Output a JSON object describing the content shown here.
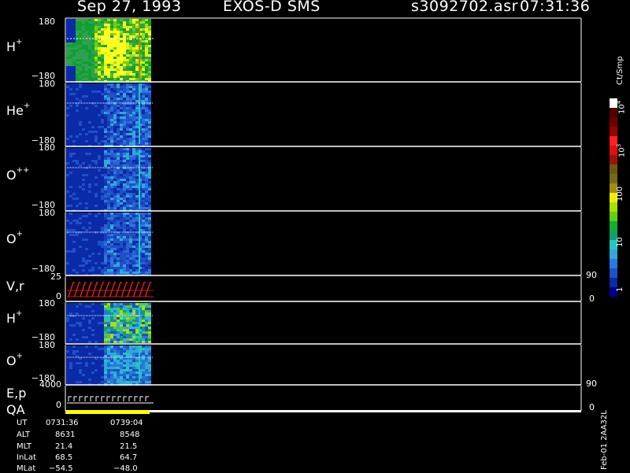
{
  "header": {
    "date": "Sep 27, 1993",
    "instrument": "EXOS-D SMS",
    "file": "s3092702.asr",
    "time": "07:31:36"
  },
  "panels": {
    "h_plus": {
      "label": "H",
      "sup": "+",
      "top": "180",
      "bottom": "−180"
    },
    "he_plus": {
      "label": "He",
      "sup": "+",
      "top": "180",
      "bottom": "−180"
    },
    "o_pp": {
      "label": "O",
      "sup": "++",
      "top": "180",
      "bottom": "−180"
    },
    "o_plus": {
      "label": "O",
      "sup": "+",
      "top": "180",
      "bottom": "−180"
    },
    "vr": {
      "label": "V,r",
      "top": "25",
      "bottom": "0",
      "right_top": "90",
      "right_bottom": "0"
    },
    "h_plus_2": {
      "label": "H",
      "sup": "+",
      "top": "180",
      "bottom": "−180"
    },
    "o_plus_2": {
      "label": "O",
      "sup": "+",
      "top": "180",
      "bottom": "−180"
    },
    "ep": {
      "label": "E,p",
      "top": "4000",
      "bottom": "0",
      "right_top": "90",
      "right_bottom": "0"
    },
    "qa": {
      "label": "QA"
    }
  },
  "colorbar": {
    "unit": "Ct/Smp",
    "labels": {
      "l1": "1",
      "l10": "10",
      "l100": "100",
      "l1000": "10",
      "l1000_exp": "3",
      "l10000": "10",
      "l10000_exp": "4"
    },
    "colors": [
      "#00008b",
      "#0a2aa8",
      "#1e50c8",
      "#2a78e0",
      "#30a8d8",
      "#20c8c0",
      "#10a070",
      "#10b030",
      "#60d010",
      "#a8e000",
      "#e8f000",
      "#a08c10",
      "#786818",
      "#6a5a10",
      "#a01010",
      "#e01010",
      "#ff2020",
      "#9a0000",
      "#700000",
      "#500000",
      "#ffffff"
    ]
  },
  "footer": {
    "labels": [
      "UT",
      "ALT",
      "MLT",
      "InLat",
      "MLat"
    ],
    "start": [
      "0731:36",
      "8631",
      "21.4",
      "68.5",
      "−54.5"
    ],
    "end": [
      "0739:04",
      "8548",
      "21.5",
      "64.7",
      "−48.0"
    ],
    "stamp": "Feb-01 2AA32L"
  },
  "chart_data": [
    {
      "type": "heatmap",
      "title": "H+",
      "ylim": [
        -180,
        180
      ],
      "x_range": [
        "0731:36",
        "0739:04"
      ]
    },
    {
      "type": "heatmap",
      "title": "He+",
      "ylim": [
        -180,
        180
      ]
    },
    {
      "type": "heatmap",
      "title": "O++",
      "ylim": [
        -180,
        180
      ]
    },
    {
      "type": "heatmap",
      "title": "O+",
      "ylim": [
        -180,
        180
      ]
    },
    {
      "type": "line",
      "title": "V,r",
      "ylim": [
        0,
        25
      ],
      "y2lim": [
        0,
        90
      ]
    },
    {
      "type": "heatmap",
      "title": "H+",
      "ylim": [
        -180,
        180
      ]
    },
    {
      "type": "heatmap",
      "title": "O+",
      "ylim": [
        -180,
        180
      ]
    },
    {
      "type": "line",
      "title": "E,p",
      "ylim": [
        0,
        4000
      ],
      "y2lim": [
        0,
        90
      ]
    },
    {
      "type": "bar",
      "title": "QA"
    }
  ]
}
